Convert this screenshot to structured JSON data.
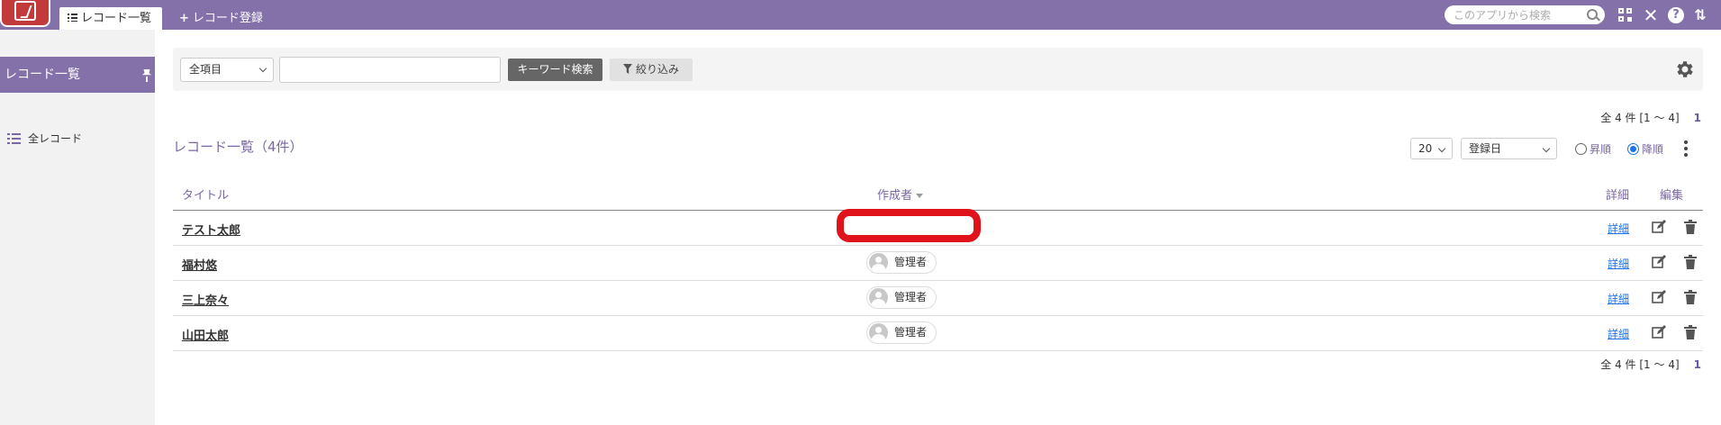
{
  "header": {
    "tabs": [
      {
        "label": "レコード一覧"
      },
      {
        "label": "レコード登録",
        "prefix": "+"
      }
    ],
    "search_placeholder": "このアプリから検索",
    "icons": [
      "app-logo-icon",
      "search-icon",
      "qr-code-icon",
      "tools-icon",
      "help-icon",
      "switch-icon"
    ]
  },
  "sidebar": {
    "header_label": "レコード一覧",
    "items": [
      {
        "label": "全レコード"
      }
    ]
  },
  "filter": {
    "field_select": "全項目",
    "keyword_value": "",
    "keyword_button": "キーワード検索",
    "narrow_button": "絞り込み"
  },
  "list": {
    "title": "レコード一覧（4件）",
    "count_text": "全 4 件 [1 ～ 4]",
    "page": "1",
    "per_page": "20",
    "sort_field": "登録日",
    "sort_asc_label": "昇順",
    "sort_desc_label": "降順",
    "sort_selected": "降順"
  },
  "table": {
    "headers": {
      "title": "タイトル",
      "author": "作成者",
      "detail": "詳細",
      "edit": "編集"
    },
    "detail_link_label": "詳細",
    "rows": [
      {
        "title": "テスト太郎",
        "author": ""
      },
      {
        "title": "福村悠",
        "author": "管理者"
      },
      {
        "title": "三上奈々",
        "author": "管理者"
      },
      {
        "title": "山田太郎",
        "author": "管理者"
      }
    ]
  },
  "colors": {
    "brand": "#8571aa",
    "link": "#1a73e8",
    "highlight": "#e0121a"
  }
}
